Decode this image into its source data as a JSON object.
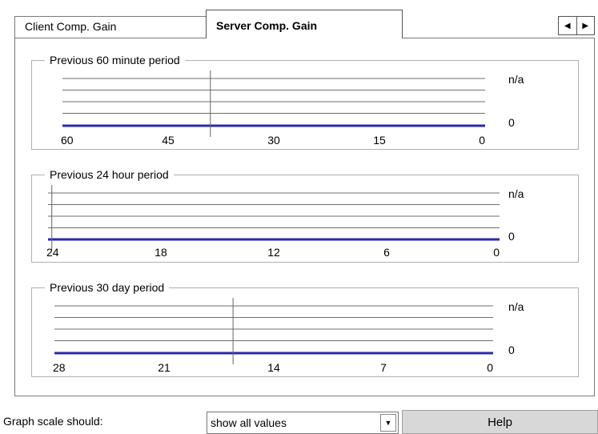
{
  "tabs": [
    {
      "label": "Client Comp. Gain",
      "active": false
    },
    {
      "label": "Server Comp. Gain",
      "active": true
    }
  ],
  "tab_scroll": {
    "left_icon": "triangle-left-icon",
    "right_icon": "triangle-right-icon"
  },
  "graphs": [
    {
      "title": "Previous 60 minute period",
      "top_label": "n/a",
      "bottom_label": "0",
      "x_ticks": [
        "60",
        "45",
        "30",
        "15",
        "0"
      ],
      "x_range": [
        60,
        0
      ],
      "cursor_x": 39
    },
    {
      "title": "Previous 24 hour period",
      "top_label": "n/a",
      "bottom_label": "0",
      "x_ticks": [
        "24",
        "18",
        "12",
        "6",
        "0"
      ],
      "x_range": [
        24,
        0
      ],
      "cursor_x": 23.8
    },
    {
      "title": "Previous 30 day period",
      "top_label": "n/a",
      "bottom_label": "0",
      "x_ticks": [
        "28",
        "21",
        "14",
        "7",
        "0"
      ],
      "x_range": [
        28,
        0
      ],
      "cursor_x": 16.6
    }
  ],
  "colors": {
    "data_line": "#2a2aa8",
    "grid_line": "#6e6e6e",
    "cursor_line": "#666666"
  },
  "bottom": {
    "scale_label": "Graph scale should:",
    "scale_value": "show all values",
    "help_label": "Help"
  }
}
